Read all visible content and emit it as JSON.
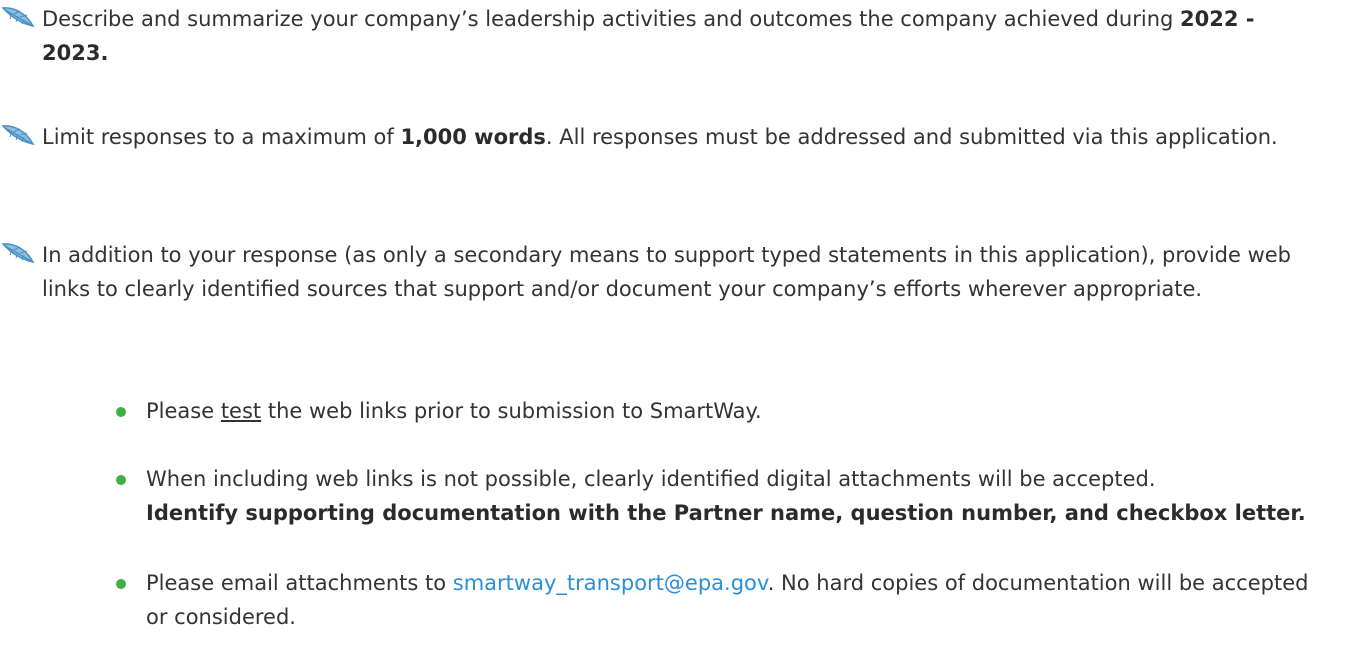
{
  "colors": {
    "text": "#333333",
    "bullet": "#3cb043",
    "link": "#2a8fd6",
    "leaf_icon": "#4a90c2"
  },
  "icons": {
    "item_marker": "leaf-icon",
    "bullet_marker": "green-dot"
  },
  "instructions": [
    {
      "text_before": "Describe and summarize your company’s leadership activities and outcomes the company achieved during ",
      "bold": "2022 - 2023.",
      "text_after": ""
    },
    {
      "text_before": "Limit responses to a maximum of ",
      "bold": "1,000 words",
      "text_after": ".  All responses must be addressed and submitted via this application."
    },
    {
      "text": "In addition to your response (as only a secondary means to support typed statements in this application), provide web links to clearly identified sources that support and/or document your company’s efforts wherever appropriate."
    }
  ],
  "bullets": [
    {
      "text_before": "Please ",
      "underlined": "test",
      "text_after": " the web links prior to submission to SmartWay."
    },
    {
      "text": "When including web links is not possible, clearly identified digital attachments will be accepted.",
      "bold": "Identify supporting documentation with the Partner name, question number, and checkbox letter."
    },
    {
      "text_before": "Please email attachments to ",
      "link": "smartway_transport@epa.gov",
      "text_after": ". No hard copies of documentation will be accepted or considered."
    }
  ]
}
